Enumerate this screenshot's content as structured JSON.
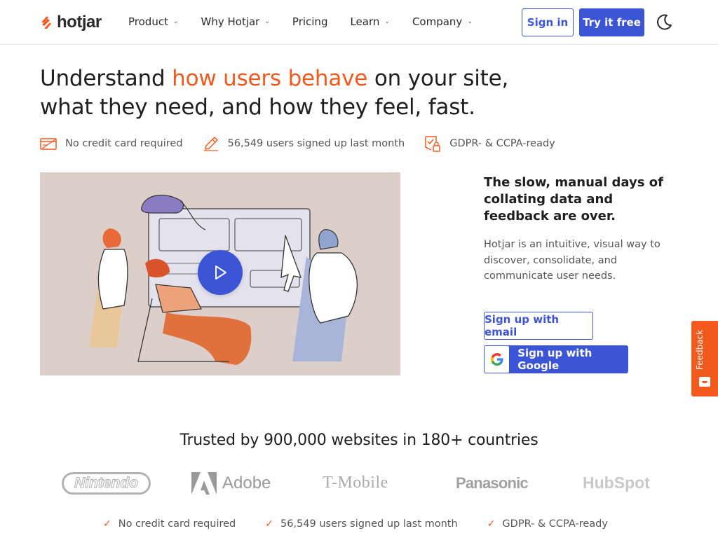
{
  "header": {
    "logo_text": "hotjar",
    "nav": [
      {
        "label": "Product",
        "has_dropdown": true
      },
      {
        "label": "Why Hotjar",
        "has_dropdown": true
      },
      {
        "label": "Pricing",
        "has_dropdown": false
      },
      {
        "label": "Learn",
        "has_dropdown": true
      },
      {
        "label": "Company",
        "has_dropdown": true
      }
    ],
    "sign_in_label": "Sign in",
    "try_free_label": "Try it free",
    "theme_toggle_icon": "moon-icon"
  },
  "hero": {
    "headline_part1": "Understand ",
    "headline_accent": "how users behave",
    "headline_part2": " on your site, what they need, and how they feel, fast.",
    "features": [
      {
        "icon": "credit-card-icon",
        "label": "No credit card required"
      },
      {
        "icon": "pencil-icon",
        "label": "56,549 users signed up last month"
      },
      {
        "icon": "shield-lock-icon",
        "label": "GDPR- & CCPA-ready"
      }
    ],
    "video_play_icon": "play-icon"
  },
  "side": {
    "subhead": "The slow, manual days of collating data and feedback are over.",
    "description": "Hotjar is an intuitive, visual way to discover, consolidate, and communicate user needs.",
    "email_button_label": "Sign up with email",
    "google_button_label": "Sign up with Google"
  },
  "feedback_tab": {
    "label": "Feedback"
  },
  "trusted": {
    "heading": "Trusted by 900,000 websites in 180+ countries",
    "brands": [
      "Nintendo",
      "Adobe",
      "T-Mobile",
      "Panasonic",
      "HubSpot"
    ]
  },
  "bottom_features": [
    "No credit card required",
    "56,549 users signed up last month",
    "GDPR- & CCPA-ready"
  ],
  "colors": {
    "accent": "#f25a1d",
    "primary": "#3c55d6",
    "text": "#1f1f1f",
    "muted": "#555555"
  }
}
